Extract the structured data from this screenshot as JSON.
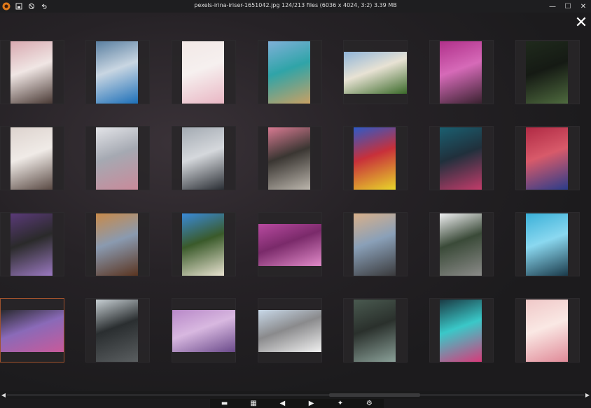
{
  "window": {
    "title": "pexels-irina-iriser-1651042.jpg 124/213 files (6036 x 4024, 3:2) 3.39 MB",
    "controls": [
      "—",
      "☐",
      "✕"
    ]
  },
  "close_overlay": "✕",
  "grid": {
    "rows": [
      [
        {
          "name": "pink-cafe-chef",
          "colors": [
            "#d8a9b0",
            "#4a3a35",
            "#f0e6e4"
          ],
          "orient": "portrait"
        },
        {
          "name": "frozen-blue-heart",
          "colors": [
            "#5a7fa0",
            "#1d6fb8",
            "#c9d6e2"
          ],
          "orient": "portrait"
        },
        {
          "name": "pink-blossom-light",
          "colors": [
            "#f2e8e6",
            "#e9b7c4",
            "#f6f0ef"
          ],
          "orient": "portrait"
        },
        {
          "name": "palace-pool",
          "colors": [
            "#7fb0d8",
            "#c9a063",
            "#2fa4a8"
          ],
          "orient": "portrait"
        },
        {
          "name": "castle-garden",
          "colors": [
            "#8fb4d8",
            "#3b6a2a",
            "#e8e2d4"
          ],
          "orient": "landscape"
        },
        {
          "name": "bougainvillea",
          "colors": [
            "#b0308a",
            "#3a2230",
            "#d66ab8"
          ],
          "orient": "portrait"
        },
        {
          "name": "fern-leaves",
          "colors": [
            "#1f2a1c",
            "#4e6a3e",
            "#151a14"
          ],
          "orient": "portrait"
        }
      ],
      [
        {
          "name": "blossom-table",
          "colors": [
            "#ddd3ce",
            "#5a4a44",
            "#f0ebe7"
          ],
          "orient": "portrait"
        },
        {
          "name": "eiffel-blossom",
          "colors": [
            "#e3e4e8",
            "#c98a9a",
            "#a5a9b2"
          ],
          "orient": "portrait"
        },
        {
          "name": "misty-castle",
          "colors": [
            "#a3aab2",
            "#2a2e34",
            "#d5d8dc"
          ],
          "orient": "portrait"
        },
        {
          "name": "rose-window",
          "colors": [
            "#d87a92",
            "#bcb6ad",
            "#3a3632"
          ],
          "orient": "portrait"
        },
        {
          "name": "graffiti-wall",
          "colors": [
            "#2e5ac8",
            "#e8d62a",
            "#c8303a"
          ],
          "orient": "portrait"
        },
        {
          "name": "teal-pink-abstract",
          "colors": [
            "#1a5f70",
            "#c23c6a",
            "#20303c"
          ],
          "orient": "portrait"
        },
        {
          "name": "red-blue-paint",
          "colors": [
            "#b02a44",
            "#2a3c8a",
            "#d85a6a"
          ],
          "orient": "portrait"
        }
      ],
      [
        {
          "name": "purple-lilac",
          "colors": [
            "#5a3a78",
            "#9a78c0",
            "#2a2a2a"
          ],
          "orient": "portrait"
        },
        {
          "name": "autumn-castle",
          "colors": [
            "#c88a4a",
            "#5a3420",
            "#8a9ab0"
          ],
          "orient": "portrait"
        },
        {
          "name": "castle-blue-sky",
          "colors": [
            "#3a8ad8",
            "#e8e2d0",
            "#3a5a2a"
          ],
          "orient": "portrait"
        },
        {
          "name": "pink-leaves",
          "colors": [
            "#b84aa0",
            "#e08ac8",
            "#7a2a6a"
          ],
          "orient": "landscape"
        },
        {
          "name": "japanese-castle-reflection",
          "colors": [
            "#d8b08a",
            "#3a3a3c",
            "#8aa0b8"
          ],
          "orient": "portrait"
        },
        {
          "name": "neuschwanstein",
          "colors": [
            "#f0f0f2",
            "#8a8a88",
            "#3a4a38"
          ],
          "orient": "portrait"
        },
        {
          "name": "blue-spiral-building",
          "colors": [
            "#3ab0d8",
            "#1a3a4a",
            "#8ad8f0"
          ],
          "orient": "portrait"
        }
      ],
      [
        {
          "name": "dark-flowers",
          "colors": [
            "#2a2a30",
            "#c85a9a",
            "#8a6ab8"
          ],
          "orient": "landscape",
          "selected": true
        },
        {
          "name": "escalator-pool",
          "colors": [
            "#c8d0d4",
            "#5a5e60",
            "#2a2e30"
          ],
          "orient": "portrait"
        },
        {
          "name": "lilac-cluster",
          "colors": [
            "#b888c8",
            "#6a4a8a",
            "#d8b8e0"
          ],
          "orient": "landscape"
        },
        {
          "name": "white-japanese-castle",
          "colors": [
            "#c8d8e8",
            "#f0f0f0",
            "#8a8a8c"
          ],
          "orient": "landscape"
        },
        {
          "name": "succulents",
          "colors": [
            "#4a5a50",
            "#8aa098",
            "#2a302c"
          ],
          "orient": "portrait"
        },
        {
          "name": "graffiti-teal-pink",
          "colors": [
            "#1a3a44",
            "#d83a7a",
            "#3ac8c8"
          ],
          "orient": "portrait"
        },
        {
          "name": "pink-roses",
          "colors": [
            "#f0c8c8",
            "#e08a98",
            "#fae8e4"
          ],
          "orient": "portrait"
        }
      ]
    ]
  },
  "scrollbar": {
    "left": "◀",
    "right": "▶"
  },
  "toolbar": [
    {
      "name": "open-folder-icon",
      "glyph": "▬"
    },
    {
      "name": "gallery-icon",
      "glyph": "▦"
    },
    {
      "name": "previous-icon",
      "glyph": "◀"
    },
    {
      "name": "next-icon",
      "glyph": "▶"
    },
    {
      "name": "magic-wand-icon",
      "glyph": "✦"
    },
    {
      "name": "settings-icon",
      "glyph": "⚙"
    }
  ]
}
